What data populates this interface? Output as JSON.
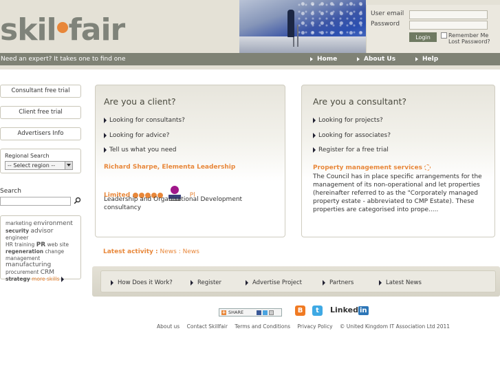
{
  "header": {
    "logo_left": "skil",
    "logo_right": "fair",
    "login": {
      "user_email_label": "User email",
      "password_label": "Password",
      "login_button": "Login",
      "remember_me": "Remember Me",
      "lost_password": "Lost Password?"
    }
  },
  "navbar": {
    "tagline": "Need an expert? It takes one to find one",
    "items": [
      "Home",
      "About Us",
      "Help"
    ]
  },
  "sidebar": {
    "buttons": [
      "Consultant free trial",
      "Client free trial",
      "Advertisers Info"
    ],
    "regional_search_label": "Regional Search",
    "region_select": "-- Select region --",
    "search_label": "Search",
    "tags": {
      "marketing": "marketing",
      "environment": "environment",
      "security": "security",
      "advisor": "advisor",
      "engineer": "engineer",
      "hr_training": "HR training",
      "pr": "PR",
      "web_site": "web site",
      "regeneration": "regeneration",
      "change_management": "change management",
      "manufacturing": "manufacturing",
      "procurement": "procurement",
      "crm": "CRM",
      "strategy": "strategy",
      "more_skills": "more skills"
    }
  },
  "client_panel": {
    "title": "Are you a client?",
    "links": [
      "Looking for consultants?",
      "Looking for advice?",
      "Tell us what you need"
    ],
    "featured_name": "Richard Sharpe, Elementa Leadership",
    "featured_limited": "Limited",
    "featured_pl": "Pl",
    "featured_rating": 5,
    "featured_desc": "Leadership and Organisational Development consultancy"
  },
  "consultant_panel": {
    "title": "Are you a consultant?",
    "links": [
      "Looking for projects?",
      "Looking for associates?",
      "Register for a free trial"
    ],
    "project_title": "Property management services",
    "project_desc": "The Council has in place specific arrangements for the management of its non-operational and let properties (hereinafter referred to as the \"Corporately managed property estate - abbreviated to CMP Estate). These properties are categorised into prope....."
  },
  "latest_activity": {
    "label": "Latest activity :",
    "item1": "News",
    "sep": ":",
    "item2": "News"
  },
  "bottom_nav": [
    "How Does it Work?",
    "Register",
    "Advertise Project",
    "Partners",
    "Latest News"
  ],
  "share": {
    "share_label": "SHARE",
    "linkedin_prefix": "Linked",
    "linkedin_suffix": "in"
  },
  "footer": [
    "About us",
    "Contact Skillfair",
    "Terms and Conditions",
    "Privacy Policy",
    "© United Kingdom IT Association Ltd 2011"
  ],
  "colors": {
    "accent_orange": "#e8873a",
    "nav_grey": "#7f8275",
    "header_beige": "#e4e1d6"
  }
}
